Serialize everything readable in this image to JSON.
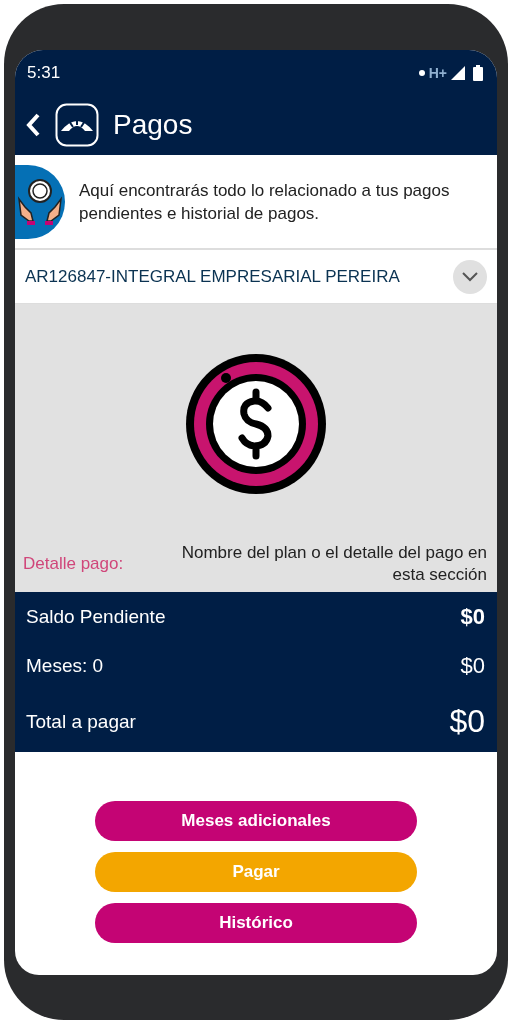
{
  "status_bar": {
    "time": "5:31",
    "network": "H+"
  },
  "header": {
    "title": "Pagos"
  },
  "banner": {
    "text": "Aquí encontrarás todo lo relacionado a tus pagos pendientes e historial de pagos."
  },
  "account_select": {
    "value": "AR126847-INTEGRAL EMPRESARIAL PEREIRA"
  },
  "detail": {
    "label": "Detalle pago:",
    "text": "Nombre del plan o el detalle del pago en esta sección"
  },
  "summary": [
    {
      "label": "Saldo Pendiente",
      "value": "$0",
      "kind": "bold"
    },
    {
      "label": "Meses:  0",
      "value": "$0",
      "kind": "normal"
    },
    {
      "label": "Total a pagar",
      "value": "$0",
      "kind": "total"
    }
  ],
  "buttons": [
    {
      "label": "Meses adicionales",
      "kind": "primary"
    },
    {
      "label": "Pagar",
      "kind": "accent"
    },
    {
      "label": "Histórico",
      "kind": "primary"
    }
  ]
}
